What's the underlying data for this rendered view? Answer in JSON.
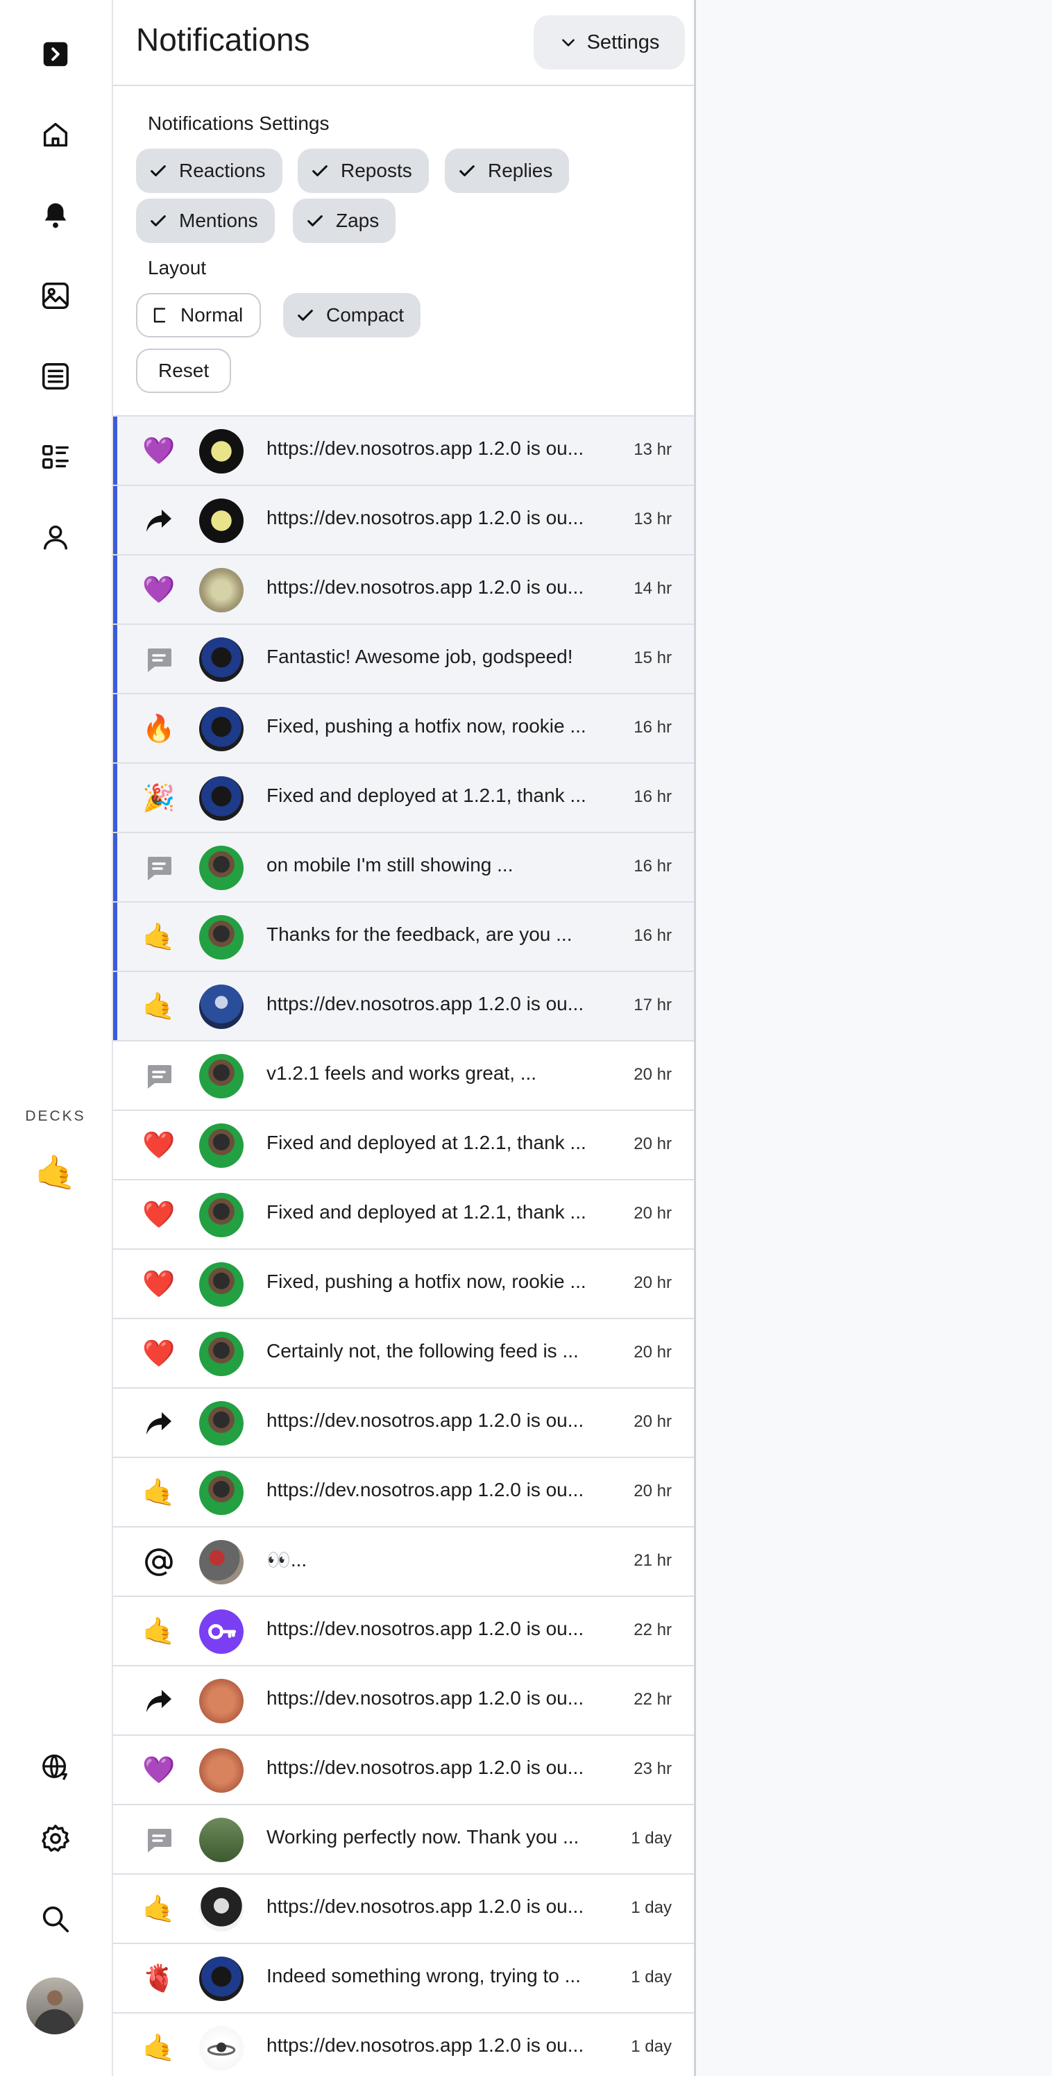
{
  "sidebar": {
    "decks_label": "DECKS",
    "deck_emoji": "🤙"
  },
  "header": {
    "title": "Notifications",
    "settings_label": "Settings"
  },
  "settings": {
    "section_label": "Notifications Settings",
    "filters": [
      "Reactions",
      "Reposts",
      "Replies",
      "Mentions",
      "Zaps"
    ],
    "layout_label": "Layout",
    "layout_normal": "Normal",
    "layout_compact": "Compact",
    "reset_label": "Reset"
  },
  "notifications": [
    {
      "icon": "💜",
      "text": "https://dev.nosotros.app 1.2.0 is ou...",
      "time": "13 hr"
    },
    {
      "icon": "repost",
      "text": "https://dev.nosotros.app 1.2.0 is ou...",
      "time": "13 hr"
    },
    {
      "icon": "💜",
      "text": "https://dev.nosotros.app 1.2.0 is ou...",
      "time": "14 hr"
    },
    {
      "icon": "reply",
      "text": "Fantastic! Awesome job, godspeed!",
      "time": "15 hr"
    },
    {
      "icon": "🔥",
      "text": "Fixed, pushing a hotfix now, rookie ...",
      "time": "16 hr"
    },
    {
      "icon": "🎉",
      "text": "Fixed and deployed at 1.2.1, thank ...",
      "time": "16 hr"
    },
    {
      "icon": "reply",
      "text": "on mobile I'm still showing ...",
      "time": "16 hr"
    },
    {
      "icon": "🤙",
      "text": "Thanks for the feedback, are you ...",
      "time": "16 hr"
    },
    {
      "icon": "🤙",
      "text": "https://dev.nosotros.app 1.2.0 is ou...",
      "time": "17 hr"
    },
    {
      "icon": "reply",
      "text": "v1.2.1 feels and works great, ...",
      "time": "20 hr"
    },
    {
      "icon": "❤️",
      "text": "Fixed and deployed at 1.2.1, thank ...",
      "time": "20 hr"
    },
    {
      "icon": "❤️",
      "text": "Fixed and deployed at 1.2.1, thank ...",
      "time": "20 hr"
    },
    {
      "icon": "❤️",
      "text": "Fixed, pushing a hotfix now, rookie ...",
      "time": "20 hr"
    },
    {
      "icon": "❤️",
      "text": "Certainly not, the following feed is ...",
      "time": "20 hr"
    },
    {
      "icon": "repost",
      "text": "https://dev.nosotros.app 1.2.0 is ou...",
      "time": "20 hr"
    },
    {
      "icon": "🤙",
      "text": "https://dev.nosotros.app 1.2.0 is ou...",
      "time": "20 hr"
    },
    {
      "icon": "mention",
      "text": "👀...",
      "time": "21 hr"
    },
    {
      "icon": "🤙",
      "text": "https://dev.nosotros.app 1.2.0 is ou...",
      "time": "22 hr"
    },
    {
      "icon": "repost",
      "text": "https://dev.nosotros.app 1.2.0 is ou...",
      "time": "22 hr"
    },
    {
      "icon": "💜",
      "text": "https://dev.nosotros.app 1.2.0 is ou...",
      "time": "23 hr"
    },
    {
      "icon": "reply",
      "text": "Working perfectly now. Thank you ...",
      "time": "1 day"
    },
    {
      "icon": "🤙",
      "text": "https://dev.nosotros.app 1.2.0 is ou...",
      "time": "1 day"
    },
    {
      "icon": "🫀",
      "text": "Indeed something wrong, trying to ...",
      "time": "1 day"
    },
    {
      "icon": "🤙",
      "text": "https://dev.nosotros.app 1.2.0 is ou...",
      "time": "1 day"
    }
  ]
}
